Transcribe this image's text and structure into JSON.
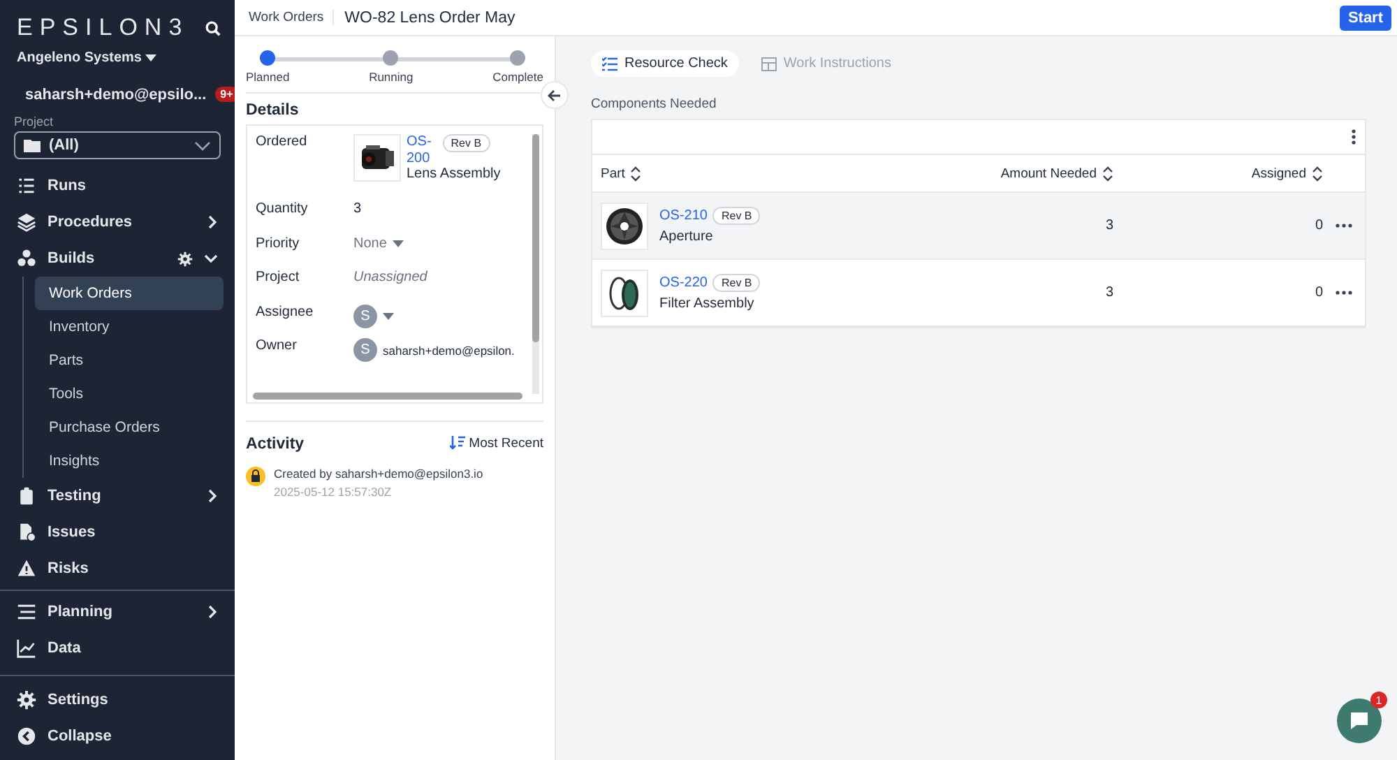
{
  "sidebar": {
    "logo": "EPSILON3",
    "organization": "Angeleno Systems",
    "user": "saharsh+demo@epsilo...",
    "notification_badge": "9+",
    "project_label": "Project",
    "project_value": "(All)",
    "groups": [
      [
        {
          "label": "Runs",
          "expandable": false,
          "gear": false
        },
        {
          "label": "Procedures",
          "expandable": true,
          "expanded": false,
          "gear": false
        },
        {
          "label": "Builds",
          "expandable": true,
          "expanded": true,
          "gear": true,
          "children": [
            {
              "label": "Work Orders",
              "selected": true
            },
            {
              "label": "Inventory",
              "selected": false
            },
            {
              "label": "Parts",
              "selected": false
            },
            {
              "label": "Tools",
              "selected": false
            },
            {
              "label": "Purchase Orders",
              "selected": false
            },
            {
              "label": "Insights",
              "selected": false
            }
          ]
        },
        {
          "label": "Testing",
          "expandable": true,
          "expanded": false,
          "gear": false
        },
        {
          "label": "Issues",
          "expandable": false,
          "gear": false
        },
        {
          "label": "Risks",
          "expandable": false,
          "gear": false
        }
      ],
      [
        {
          "label": "Planning",
          "expandable": true,
          "expanded": false,
          "gear": false
        },
        {
          "label": "Data",
          "expandable": false,
          "gear": false
        }
      ]
    ],
    "bottom": [
      {
        "label": "Settings"
      },
      {
        "label": "Collapse"
      }
    ]
  },
  "header": {
    "breadcrumb": "Work Orders",
    "title": "WO-82 Lens Order May",
    "action": "Start"
  },
  "steps": [
    {
      "label": "Planned",
      "selected": true
    },
    {
      "label": "Running",
      "selected": false
    },
    {
      "label": "Complete",
      "selected": false
    }
  ],
  "details": {
    "title": "Details",
    "rows": [
      {
        "kind": "part",
        "label": "Ordered",
        "part": "OS-\n200",
        "rev": "Rev B",
        "name": "Lens Assembly"
      },
      {
        "kind": "text",
        "label": "Quantity",
        "value": "3"
      },
      {
        "kind": "select",
        "label": "Priority",
        "placeholder": "None"
      },
      {
        "kind": "italic",
        "label": "Project",
        "value": "Unassigned"
      },
      {
        "kind": "avatar-select",
        "label": "Assignee",
        "value": "S"
      },
      {
        "kind": "avatar-text",
        "label": "Owner",
        "value": "S",
        "text": "saharsh+demo@epsilon."
      }
    ]
  },
  "activity": {
    "title": "Activity",
    "sort": "Most Recent",
    "entries": [
      {
        "text": "Created by saharsh+demo@epsilon3.io",
        "time": "2025-05-12 15:57:30Z"
      }
    ]
  },
  "tabs": [
    {
      "label": "Resource Check",
      "selected": true
    },
    {
      "label": "Work Instructions",
      "selected": false
    }
  ],
  "table": {
    "title": "Components Needed",
    "columns": [
      "Part",
      "Amount Needed",
      "Assigned"
    ],
    "rows": [
      {
        "part": "OS-210",
        "rev": "Rev B",
        "name": "Aperture",
        "amount": "3",
        "assigned": "0",
        "highlighted": true
      },
      {
        "part": "OS-220",
        "rev": "Rev B",
        "name": "Filter Assembly",
        "amount": "3",
        "assigned": "0",
        "highlighted": false
      }
    ]
  },
  "chat": {
    "badge": "1"
  }
}
